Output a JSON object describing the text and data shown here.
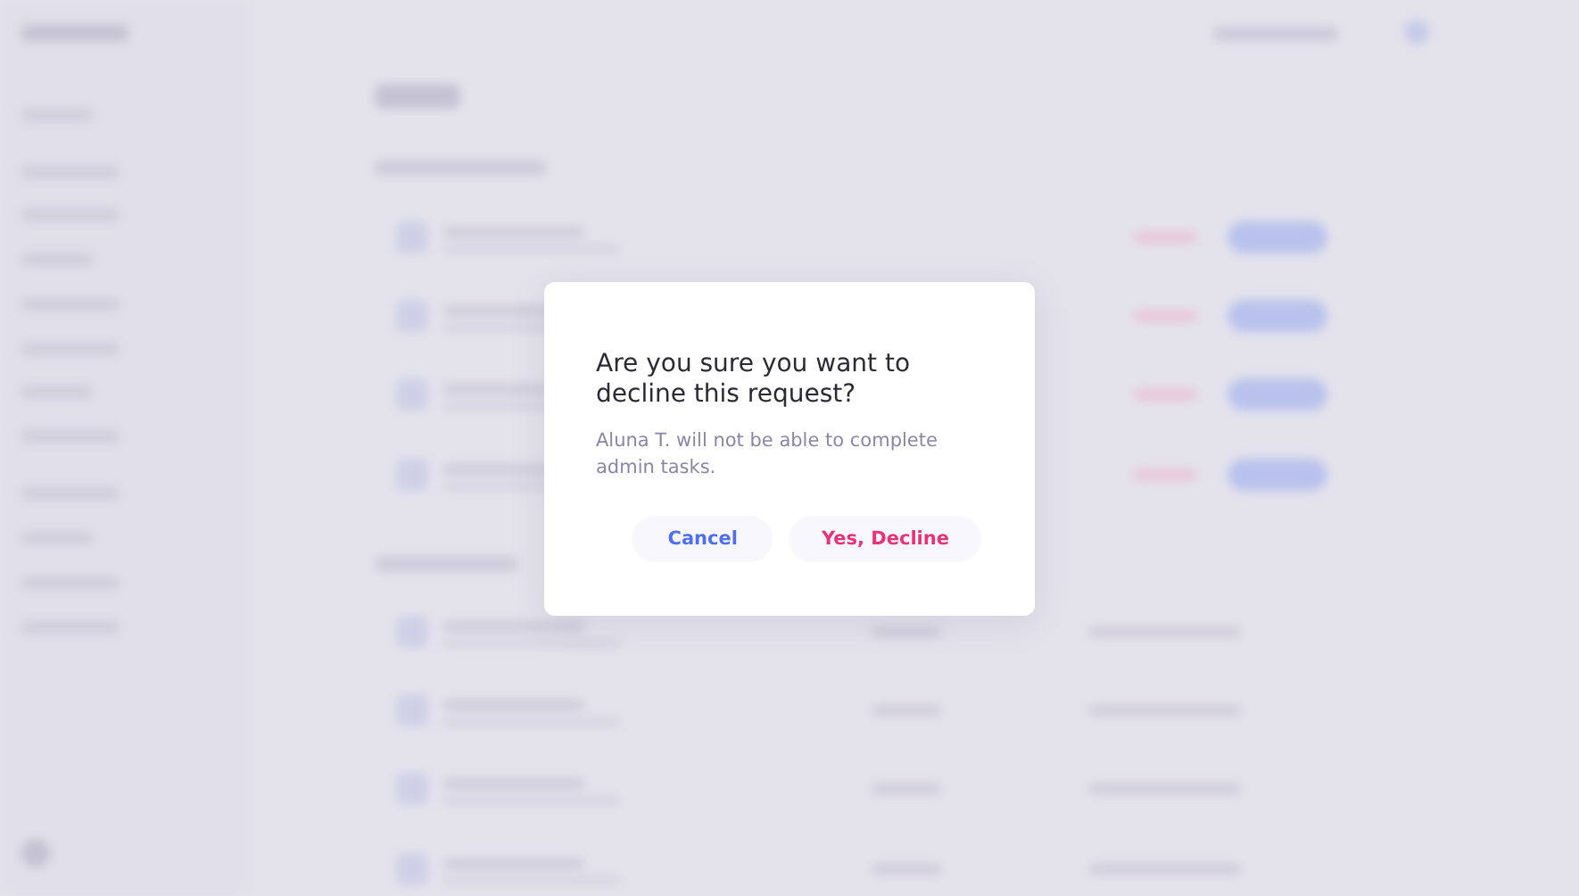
{
  "dialog": {
    "title": "Are you sure you want to decline this request?",
    "message": "Aluna T. will not be able to complete admin tasks.",
    "buttons": [
      {
        "label": "Cancel",
        "kind": "cancel"
      },
      {
        "label": "Yes, Decline",
        "kind": "danger"
      }
    ]
  }
}
